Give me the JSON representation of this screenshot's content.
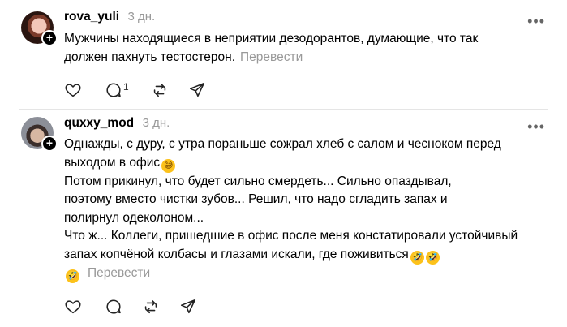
{
  "posts": [
    {
      "username": "rova_yuli",
      "time": "3 дн.",
      "lines": [
        "Мужчины находящиеся в неприятии дезодорантов, думающие, что так",
        "должен пахнуть тестостерон."
      ],
      "translate_label": "Перевести",
      "reply_count": "1"
    },
    {
      "username": "quxxy_mod",
      "time": "3 дн.",
      "lines": [
        "Однажды, с дуру, с утра пораньше сожрал хлеб с салом и чесноком перед",
        "выходом в офис",
        "Потом прикинул, что будет сильно смердеть... Сильно опаздывал,",
        "поэтому вместо чистки зубов... Решил, что надо сгладить запах и",
        "полирнул одеколоном...",
        "Что ж... Коллеги, пришедшие в офис после меня констатировали устойчивый",
        "запах копчёной колбасы и глазами искали, где поживиться"
      ],
      "translate_label": "Перевести"
    }
  ],
  "icons": [
    "heart-icon",
    "comment-icon",
    "repost-icon",
    "share-icon",
    "more-icon",
    "follow-plus-icon"
  ],
  "colors": {
    "text": "#000000",
    "muted": "#999999",
    "divider": "#e5e5e5"
  }
}
